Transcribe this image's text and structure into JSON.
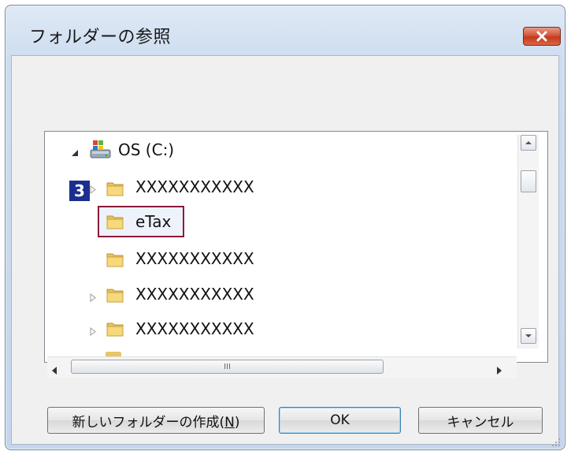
{
  "dialog": {
    "title": "フォルダーの参照",
    "close_icon": "close-x-icon"
  },
  "tree": {
    "root": {
      "label": "OS (C:)",
      "icon": "drive-icon",
      "expanded": true
    },
    "items": [
      {
        "label": "XXXXXXXXXXX",
        "icon": "folder-icon",
        "has_children": true
      },
      {
        "label": "eTax",
        "icon": "folder-icon",
        "has_children": false,
        "selected": true
      },
      {
        "label": "XXXXXXXXXXX",
        "icon": "folder-icon",
        "has_children": false
      },
      {
        "label": "XXXXXXXXXXX",
        "icon": "folder-icon",
        "has_children": true
      },
      {
        "label": "XXXXXXXXXXX",
        "icon": "folder-icon",
        "has_children": true
      }
    ]
  },
  "scrollbars": {
    "horizontal_thumb_grip": "III"
  },
  "annotation": {
    "step_number": "3"
  },
  "buttons": {
    "new_folder": "新しいフォルダーの作成(N)",
    "new_folder_accel": "N",
    "ok": "OK",
    "cancel": "キャンセル"
  },
  "colors": {
    "badge": "#1c2f8f",
    "highlight_border": "#8b1a3a",
    "close_button": "#c43b1f"
  }
}
